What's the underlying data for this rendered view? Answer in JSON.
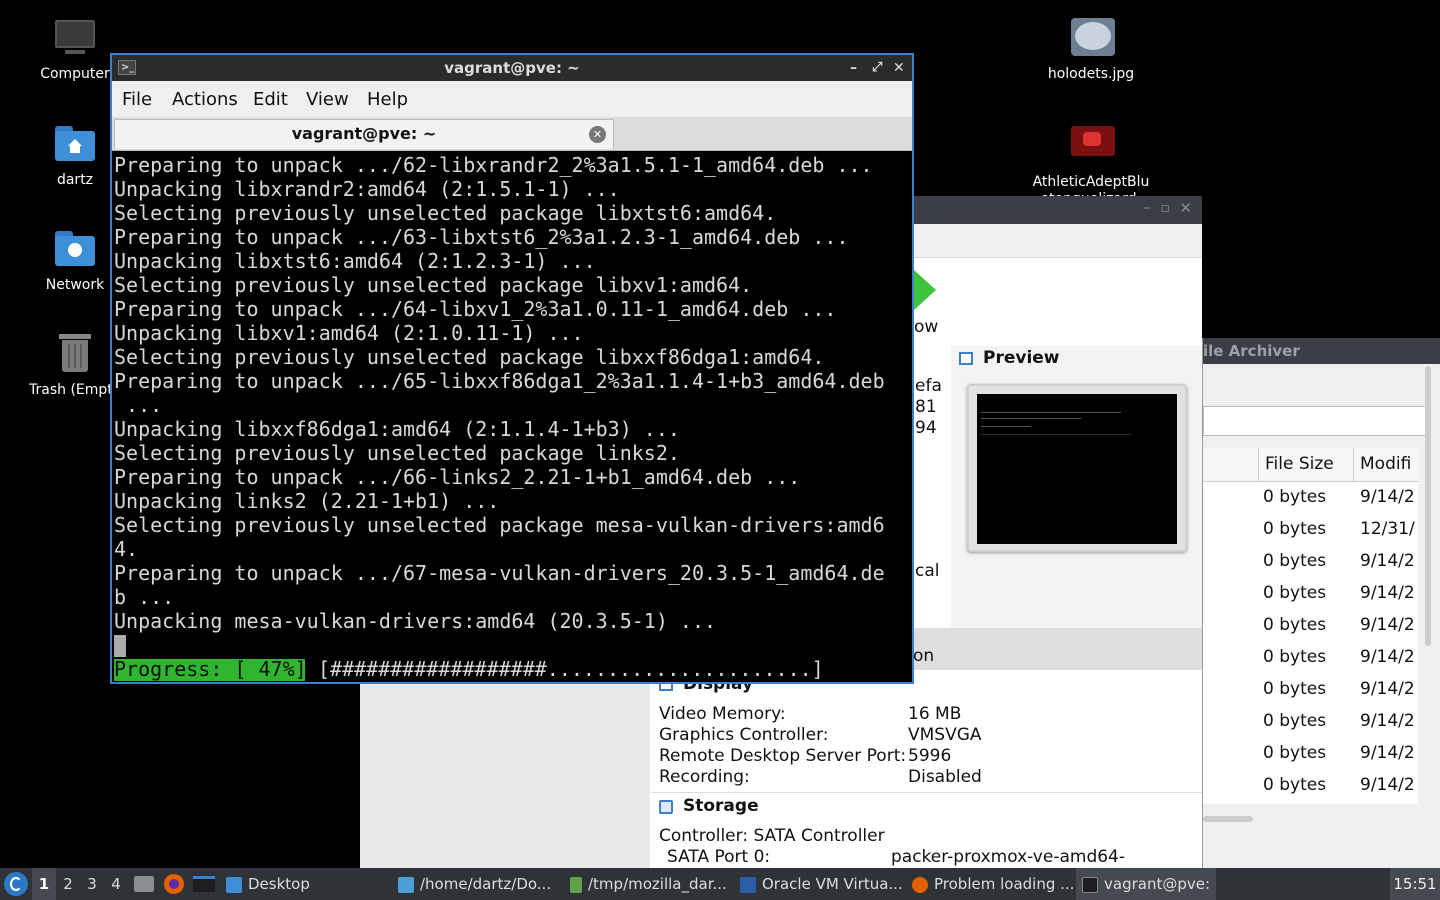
{
  "desktop": {
    "icons_left": [
      {
        "label": "Computer",
        "icon": "computer-icon"
      },
      {
        "label": "dartz",
        "icon": "home-folder-icon"
      },
      {
        "label": "Network",
        "icon": "network-folder-icon"
      },
      {
        "label": "Trash (Empty)",
        "icon": "trash-icon"
      }
    ],
    "icons_right": [
      {
        "label": "holodets.jpg",
        "icon": "image-file-icon"
      },
      {
        "label": "AthleticAdeptBluetonguelizard-",
        "icon": "image-file-icon"
      }
    ]
  },
  "terminal": {
    "title": "vagrant@pve: ~",
    "menu": [
      "File",
      "Actions",
      "Edit",
      "View",
      "Help"
    ],
    "tab_label": "vagrant@pve: ~",
    "lines": [
      "Preparing to unpack .../62-libxrandr2_2%3a1.5.1-1_amd64.deb ...",
      "Unpacking libxrandr2:amd64 (2:1.5.1-1) ...",
      "Selecting previously unselected package libxtst6:amd64.",
      "Preparing to unpack .../63-libxtst6_2%3a1.2.3-1_amd64.deb ...",
      "Unpacking libxtst6:amd64 (2:1.2.3-1) ...",
      "Selecting previously unselected package libxv1:amd64.",
      "Preparing to unpack .../64-libxv1_2%3a1.0.11-1_amd64.deb ...",
      "Unpacking libxv1:amd64 (2:1.0.11-1) ...",
      "Selecting previously unselected package libxxf86dga1:amd64.",
      "Preparing to unpack .../65-libxxf86dga1_2%3a1.1.4-1+b3_amd64.deb",
      " ...",
      "Unpacking libxxf86dga1:amd64 (2:1.1.4-1+b3) ...",
      "Selecting previously unselected package links2.",
      "Preparing to unpack .../66-links2_2.21-1+b1_amd64.deb ...",
      "Unpacking links2 (2.21-1+b1) ...",
      "Selecting previously unselected package mesa-vulkan-drivers:amd6",
      "4.",
      "Preparing to unpack .../67-mesa-vulkan-drivers_20.3.5-1_amd64.de",
      "b ...",
      "Unpacking mesa-vulkan-drivers:amd64 (20.3.5-1) ..."
    ],
    "progress_label": "Progress: [ 47%]",
    "progress_bar": "[##################......................]",
    "progress_percent": 47
  },
  "vbox": {
    "preview_title": "Preview",
    "partial_left_texts": [
      "efa",
      "81",
      "94",
      "cal",
      "on",
      "ow"
    ],
    "display": {
      "heading": "Display",
      "rows": [
        {
          "key": "Video Memory:",
          "value": "16 MB"
        },
        {
          "key": "Graphics Controller:",
          "value": "VMSVGA"
        },
        {
          "key": "Remote Desktop Server Port:",
          "value": "5996"
        },
        {
          "key": "Recording:",
          "value": "Disabled"
        }
      ]
    },
    "storage": {
      "heading": "Storage",
      "controller": "Controller: SATA Controller",
      "port_key": "SATA Port 0:",
      "port_value": "packer-proxmox-ve-amd64-"
    }
  },
  "archiver": {
    "title": "ile Archiver",
    "columns": [
      "File Size",
      "Modifi"
    ],
    "rows": [
      {
        "size": "0 bytes",
        "modified": "9/14/2"
      },
      {
        "size": "0 bytes",
        "modified": "12/31/"
      },
      {
        "size": "0 bytes",
        "modified": "9/14/2"
      },
      {
        "size": "0 bytes",
        "modified": "9/14/2"
      },
      {
        "size": "0 bytes",
        "modified": "9/14/2"
      },
      {
        "size": "0 bytes",
        "modified": "9/14/2"
      },
      {
        "size": "0 bytes",
        "modified": "9/14/2"
      },
      {
        "size": "0 bytes",
        "modified": "9/14/2"
      },
      {
        "size": "0 bytes",
        "modified": "9/14/2"
      },
      {
        "size": "0 bytes",
        "modified": "9/14/2"
      }
    ]
  },
  "taskbar": {
    "workspaces": [
      "1",
      "2",
      "3",
      "4"
    ],
    "tasks": [
      {
        "label": "Desktop",
        "icon": "folder-icon"
      },
      {
        "label": "/home/dartz/Do...",
        "icon": "image-viewer-icon"
      },
      {
        "label": "/tmp/mozilla_dar...",
        "icon": "archive-icon"
      },
      {
        "label": "Oracle VM Virtua...",
        "icon": "virtualbox-icon"
      },
      {
        "label": "Problem loading ...",
        "icon": "firefox-icon"
      },
      {
        "label": "vagrant@pve: ~",
        "icon": "terminal-icon"
      }
    ],
    "clock": "15:51"
  },
  "colors": {
    "progress_green": "#2fb52f",
    "accent_blue": "#3b7fd0",
    "folder_blue": "#3d8fd8"
  }
}
